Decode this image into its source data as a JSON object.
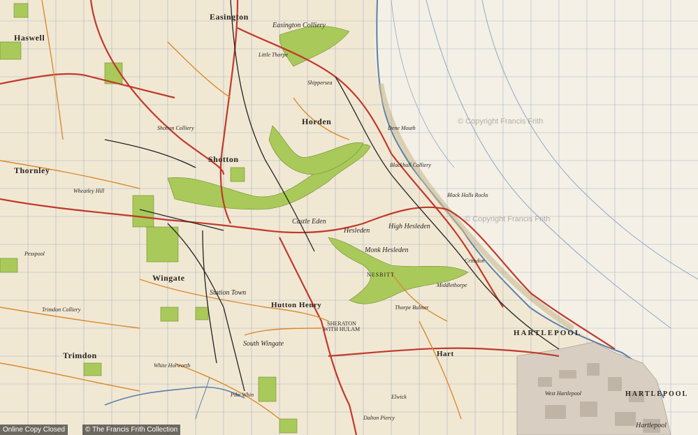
{
  "watermarks": [
    "© Copyright Francis Frith",
    "© Copyright Francis Frith"
  ],
  "footer": {
    "left": "Online Copy Closed",
    "right": "© The Francis Frith Collection"
  },
  "places": {
    "easington": "Easington",
    "easington_colliery": "Easington Colliery",
    "haswell": "Haswell",
    "horden": "Horden",
    "shotton": "Shotton",
    "shotton_colliery": "Shotton Colliery",
    "thornley": "Thornley",
    "castle_eden": "Castle Eden",
    "hesleden": "Hesleden",
    "monk_hesleden": "Monk Hesleden",
    "high_hesleden": "High Hesleden",
    "nesbitt": "NESBITT",
    "hutton_henry": "Hutton Henry",
    "south_wingate": "South Wingate",
    "wingate": "Wingate",
    "station_town": "Station Town",
    "trimdon": "Trimdon",
    "trimdon_colliery": "Trimdon Colliery",
    "sheraton_with_hulam": "SHERATON WITH HULAM",
    "hart": "Hart",
    "hartlepool_upper": "HARTLEPOOL",
    "hartlepool": "HARTLEPOOL",
    "hartlepool_script": "Hartlepool",
    "blackhall_colliery": "Blackhall Colliery",
    "blackhall_rocks": "Black Halls Rocks",
    "dene_mouth": "Dene Mouth",
    "crimdon": "Crimdon",
    "elwick": "Elwick",
    "thorpe_bulmer": "Thorpe Bulmer",
    "middlethorpe": "Middlethorpe",
    "dalton_piercy": "Dalton Piercy",
    "west_hartlepool": "West Hartlepool",
    "shippersea": "Shippersea",
    "little_thorpe": "Little Thorpe",
    "wheatley_hill": "Wheatley Hill",
    "pesspool": "Pesspool",
    "whitworth": "White Horworth",
    "pike_whin": "Pike Whin"
  }
}
